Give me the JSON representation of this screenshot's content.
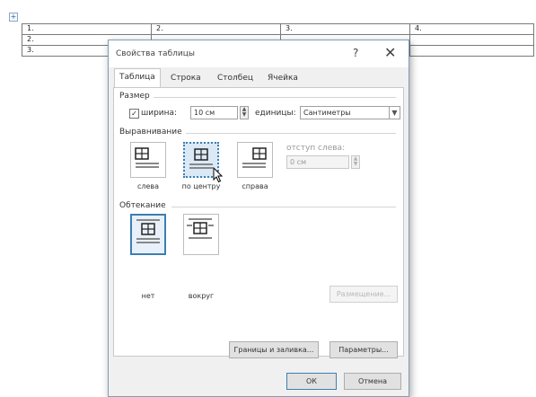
{
  "document": {
    "table_handle_icon": "move-handle-icon",
    "rows": [
      [
        "1.",
        "2.",
        "3.",
        "4."
      ],
      [
        "2.",
        "",
        "",
        ""
      ],
      [
        "3.",
        "",
        "",
        ""
      ]
    ]
  },
  "dialog": {
    "title": "Свойства таблицы",
    "help_label": "?",
    "close_label": "✕",
    "tabs": [
      {
        "label": "Таблица",
        "active": true
      },
      {
        "label": "Строка",
        "active": false
      },
      {
        "label": "Столбец",
        "active": false
      },
      {
        "label": "Ячейка",
        "active": false
      }
    ],
    "size": {
      "group_label": "Размер",
      "width_label": "ширина:",
      "width_checked": true,
      "width_value": "10 см",
      "units_label": "единицы:",
      "units_value": "Сантиметры"
    },
    "alignment": {
      "group_label": "Выравнивание",
      "options": [
        {
          "label": "слева",
          "icon": "align-left-icon",
          "state": "normal"
        },
        {
          "label": "по центру",
          "icon": "align-center-icon",
          "state": "hover"
        },
        {
          "label": "справа",
          "icon": "align-right-icon",
          "state": "normal"
        }
      ],
      "indent_label": "отступ слева:",
      "indent_value": "0 см"
    },
    "wrapping": {
      "group_label": "Обтекание",
      "options": [
        {
          "label": "нет",
          "icon": "wrap-none-icon",
          "state": "selected"
        },
        {
          "label": "вокруг",
          "icon": "wrap-around-icon",
          "state": "normal"
        }
      ],
      "positioning_label": "Размещение..."
    },
    "borders_button": "Границы и заливка...",
    "options_button": "Параметры...",
    "ok_button": "ОК",
    "cancel_button": "Отмена"
  },
  "colors": {
    "accent": "#3c7fb1",
    "dialog_bg": "#f0f0f0"
  }
}
